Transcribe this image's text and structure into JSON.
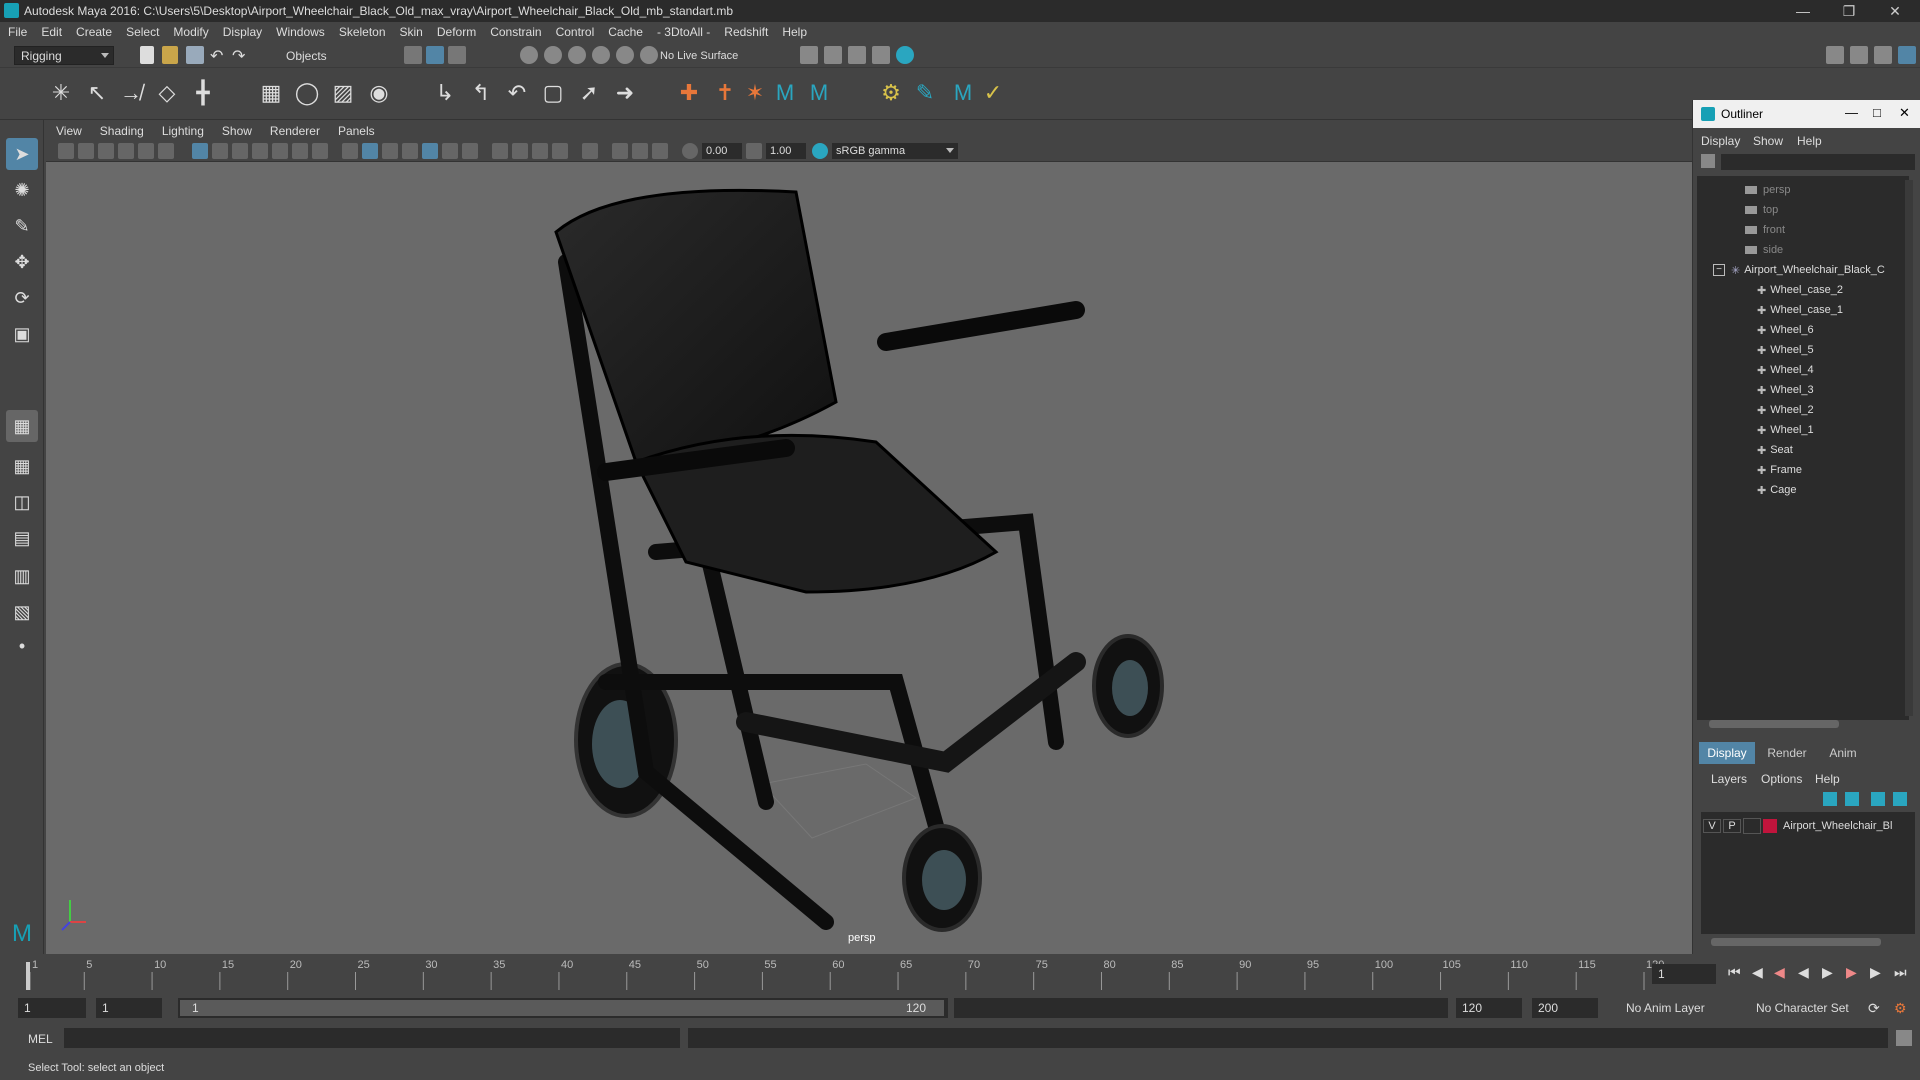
{
  "title": "Autodesk Maya 2016: C:\\Users\\5\\Desktop\\Airport_Wheelchair_Black_Old_max_vray\\Airport_Wheelchair_Black_Old_mb_standart.mb",
  "menu": [
    "File",
    "Edit",
    "Create",
    "Select",
    "Modify",
    "Display",
    "Windows",
    "Skeleton",
    "Skin",
    "Deform",
    "Constrain",
    "Control",
    "Cache",
    "- 3DtoAll -",
    "Redshift",
    "Help"
  ],
  "shelf": {
    "mode": "Rigging",
    "objects": "Objects",
    "live_surface": "No Live Surface"
  },
  "viewport_menu": [
    "View",
    "Shading",
    "Lighting",
    "Show",
    "Renderer",
    "Panels"
  ],
  "viewport_toolbar": {
    "exposure": "0.00",
    "gamma": "1.00",
    "colorspace": "sRGB gamma"
  },
  "viewport_label": "persp",
  "outliner": {
    "title": "Outliner",
    "menu": [
      "Display",
      "Show",
      "Help"
    ],
    "cameras": [
      "persp",
      "top",
      "front",
      "side"
    ],
    "group": "Airport_Wheelchair_Black_C",
    "children": [
      "Wheel_case_2",
      "Wheel_case_1",
      "Wheel_6",
      "Wheel_5",
      "Wheel_4",
      "Wheel_3",
      "Wheel_2",
      "Wheel_1",
      "Seat",
      "Frame",
      "Cage"
    ]
  },
  "channelbox": {
    "tabs": [
      "Display",
      "Render",
      "Anim"
    ],
    "menu": [
      "Layers",
      "Options",
      "Help"
    ],
    "layer": {
      "v": "V",
      "p": "P",
      "name": "Airport_Wheelchair_Bl",
      "color": "#c0143c"
    }
  },
  "timeline": {
    "ticks": [
      "1",
      "5",
      "10",
      "15",
      "20",
      "25",
      "30",
      "35",
      "40",
      "45",
      "50",
      "55",
      "60",
      "65",
      "70",
      "75",
      "80",
      "85",
      "90",
      "95",
      "100",
      "105",
      "110",
      "115",
      "120"
    ],
    "current_frame": "1"
  },
  "range": {
    "start": "1",
    "playback_start": "1",
    "range_start_label": "1",
    "range_end_label": "120",
    "playback_end": "120",
    "end": "200",
    "anim_layer": "No Anim Layer",
    "char_set": "No Character Set"
  },
  "cmd": {
    "label": "MEL"
  },
  "help": "Select Tool: select an object",
  "colors": {
    "accent": "#5285a6",
    "maya": "#17a0b5"
  }
}
